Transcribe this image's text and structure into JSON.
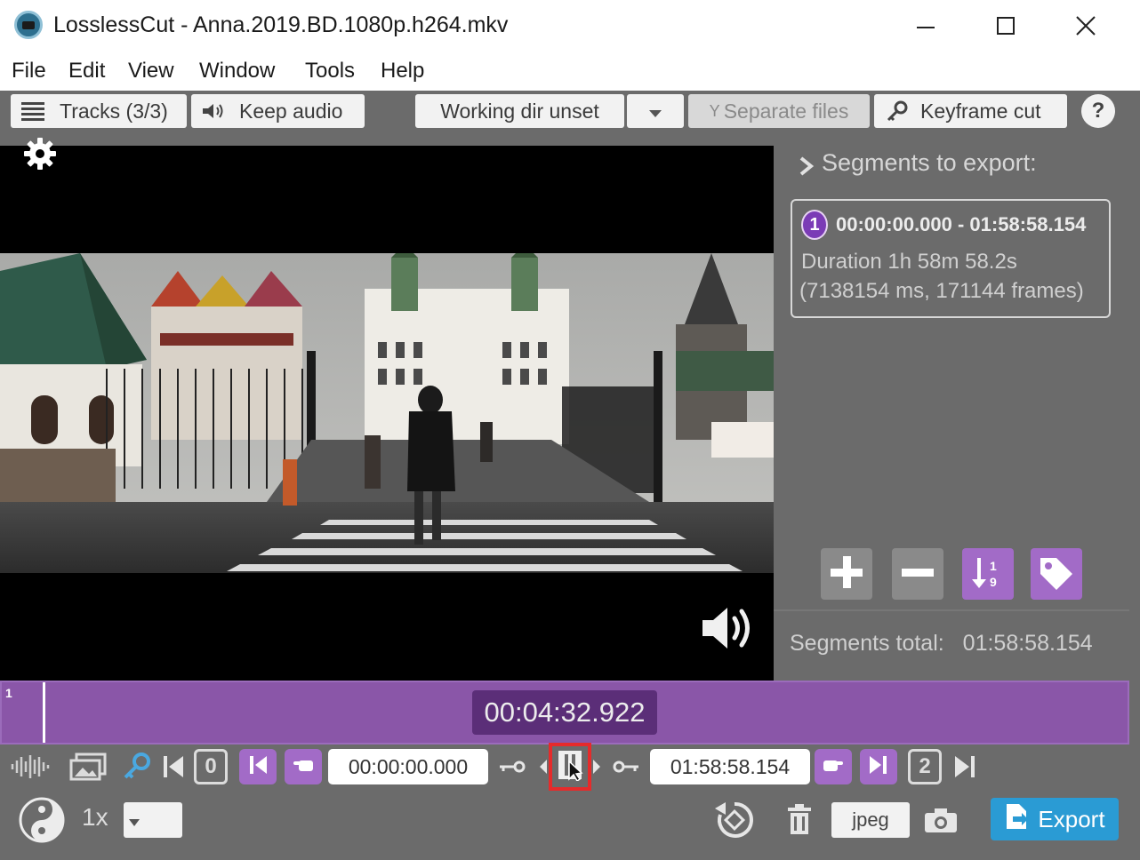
{
  "window": {
    "title": "LosslessCut - Anna.2019.BD.1080p.h264.mkv",
    "controls": [
      "minimize",
      "maximize",
      "close"
    ]
  },
  "menu": [
    "File",
    "Edit",
    "View",
    "Window",
    "Tools",
    "Help"
  ],
  "toolbar": {
    "tracks_label": "Tracks (3/3)",
    "audio_label": "Keep audio",
    "workdir_label": "Working dir unset",
    "separate_label": "Separate files",
    "keyframe_label": "Keyframe cut",
    "help_label": "?"
  },
  "segments": {
    "title": "Segments to export:",
    "items": [
      {
        "number": "1",
        "range": "00:00:00.000 - 01:58:58.154",
        "duration": "Duration 1h 58m 58.2s",
        "frames": "(7138154 ms, 171144 frames)"
      }
    ],
    "total_label": "Segments total:",
    "total_value": "01:58:58.154"
  },
  "timeline": {
    "segment_number": "1",
    "current_time": "00:04:32.922"
  },
  "controls": {
    "start_box": "0",
    "end_box": "2",
    "start_time": "00:00:00.000",
    "end_time": "01:58:58.154",
    "speed": "1x",
    "capture_format": "jpeg",
    "export_label": "Export"
  },
  "colors": {
    "accent_purple": "#a26bc7",
    "timeline_purple": "#8a56a8",
    "export_blue": "#2a9bd4",
    "app_gray": "#6b6b6b"
  }
}
